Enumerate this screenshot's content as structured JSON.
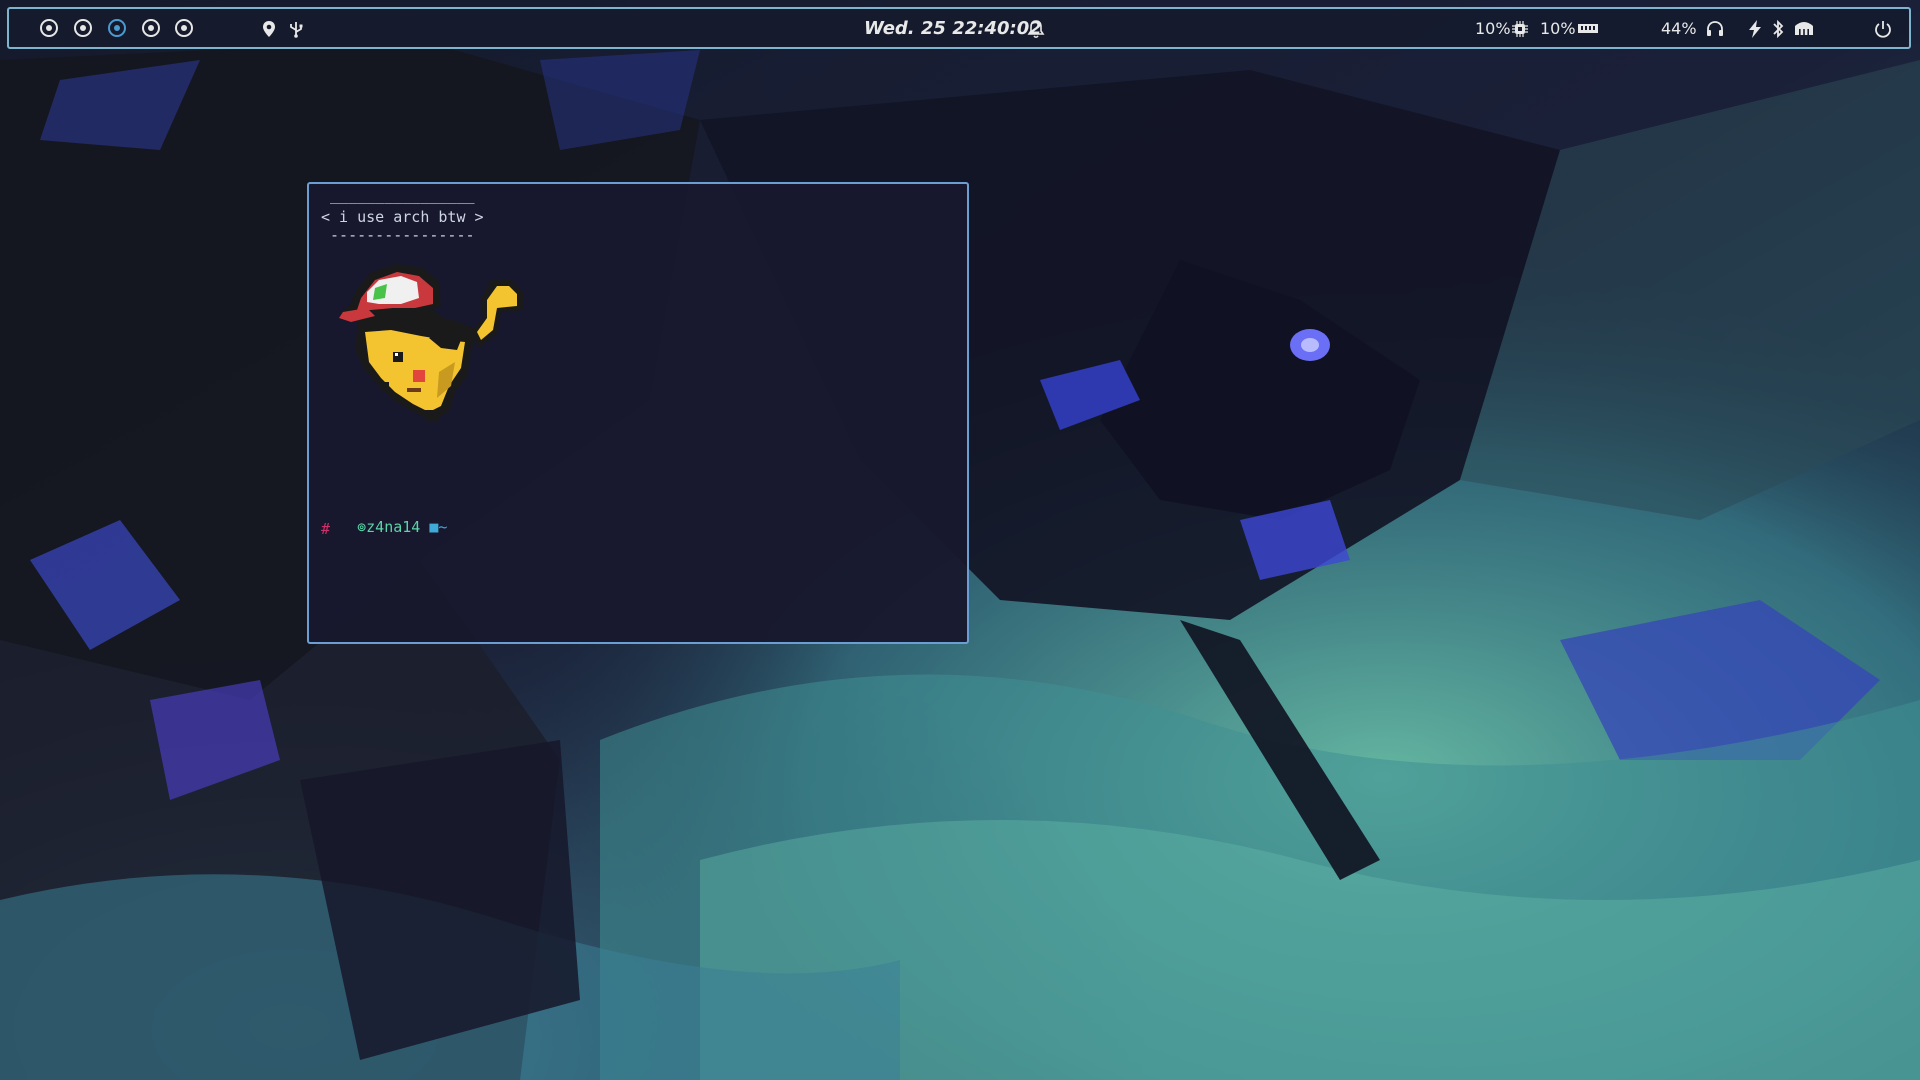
{
  "wallpaper": {
    "palette": [
      "#0f1320",
      "#1b2240",
      "#2f3ea8",
      "#4b5ad8",
      "#3f8f94",
      "#6dc0a8"
    ]
  },
  "topbar": {
    "workspaces": [
      {
        "name": "workspace-1",
        "active": false
      },
      {
        "name": "workspace-2",
        "active": false
      },
      {
        "name": "workspace-3",
        "active": true
      },
      {
        "name": "workspace-4",
        "active": false
      },
      {
        "name": "workspace-5",
        "active": false
      }
    ],
    "left_icons": [
      "map-pin-icon",
      "usb-icon"
    ],
    "clock": "Wed. 25  22:40:02",
    "cpu": "10%",
    "ram": "10%",
    "volume": "44%",
    "right_icons": [
      "cpu-icon",
      "memory-icon",
      "headphones-icon",
      "bolt-icon",
      "bluetooth-icon",
      "network-icon",
      "power-icon"
    ],
    "accent": "#7fb4cf"
  },
  "terminal": {
    "cowsay_top": " ________________",
    "cowsay_text": "< i use arch btw >",
    "cowsay_bottom": " ----------------",
    "user": "z4na14",
    "dir": "~",
    "prompt_symbol": "#",
    "border_color": "#6b9fd4"
  }
}
